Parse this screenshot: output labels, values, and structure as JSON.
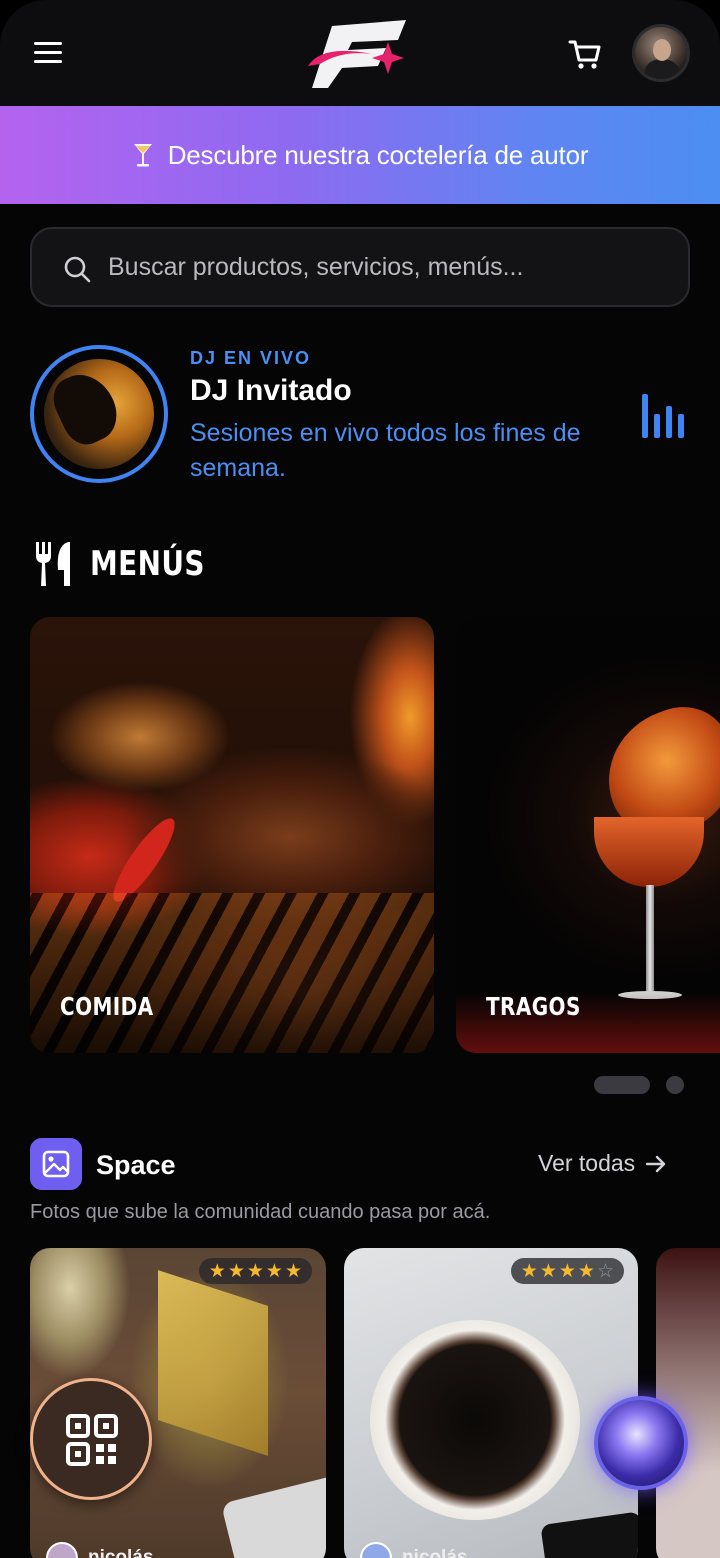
{
  "header": {
    "menu_icon": "hamburger-menu-icon",
    "logo": "brand-logo-icon",
    "cart_icon": "shopping-cart-icon",
    "avatar": "user-avatar"
  },
  "promo": {
    "icon": "cocktail-glass-icon",
    "text": "Descubre nuestra coctelería de autor"
  },
  "search": {
    "placeholder": "Buscar productos, servicios, menús...",
    "value": ""
  },
  "dj": {
    "tag": "DJ EN VIVO",
    "name": "DJ Invitado",
    "description": "Sesiones en vivo todos los fines de semana.",
    "icon": "equalizer-icon"
  },
  "menus": {
    "title": "MENÚS",
    "icon": "cutlery-icon",
    "cards": [
      {
        "label": "COMIDA"
      },
      {
        "label": "TRAGOS"
      }
    ],
    "pager": {
      "count": 2,
      "active": 1
    }
  },
  "space": {
    "title": "Space",
    "see_all": "Ver todas",
    "subtitle": "Fotos que sube la comunidad cuando pasa por acá.",
    "photos": [
      {
        "rating": 5,
        "author": "nicolás"
      },
      {
        "rating": 4,
        "author": "nicolás"
      }
    ]
  },
  "colors": {
    "accent_blue": "#3f84f2",
    "banner_start": "#b463ef",
    "banner_end": "#4c8ef2",
    "star": "#f5b82e",
    "background": "#050506"
  }
}
